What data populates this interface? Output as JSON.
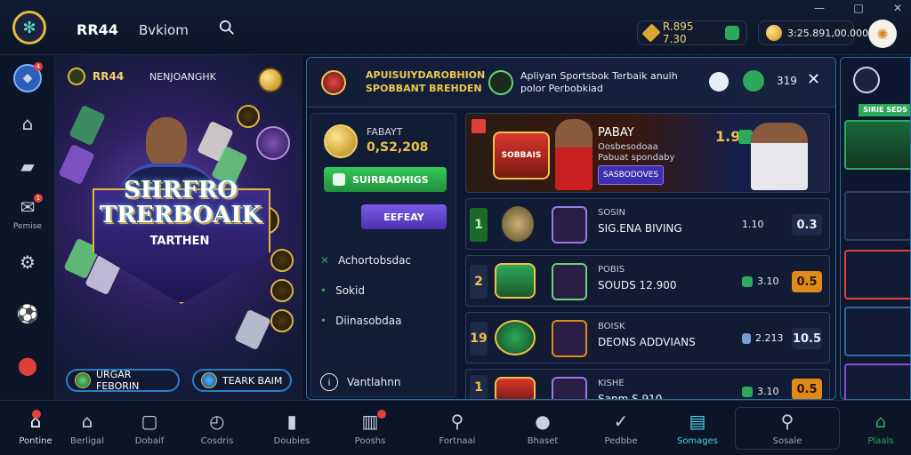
{
  "header": {
    "brand": "RR44",
    "subtitle": "Bvkiom",
    "balance1": "R.895 7.30",
    "balance2": "3:25.891,00.000",
    "window_controls": [
      "—",
      "□",
      "✕"
    ]
  },
  "leftnav": {
    "items": [
      {
        "name": "shield",
        "label": ""
      },
      {
        "name": "home",
        "label": ""
      },
      {
        "name": "tickets",
        "label": ""
      },
      {
        "name": "inbox",
        "label": "Pemise"
      },
      {
        "name": "settings",
        "label": ""
      },
      {
        "name": "ball",
        "label": ""
      },
      {
        "name": "location",
        "label": ""
      }
    ]
  },
  "hero": {
    "top_label": "RR44",
    "top_sub": "NENJOANGHK",
    "title_line1": "SHRFRO",
    "title_line2": "TRERBOAIK",
    "tag": "TARTHEN",
    "btn_left": "URGAR FEBORIN",
    "btn_right": "TEARK BAIM"
  },
  "banner": {
    "text1_line1": "APUISUIYDAROBHION",
    "text1_line2": "SPOBBANT BREHDEN",
    "text2_line1": "Apliyan Sportsbok Terbaik anuih",
    "text2_line2": "polor Perbobkiad",
    "count": "319"
  },
  "sidepane": {
    "label": "FABAYT",
    "value": "0,S2,208",
    "btn1": "SUIRBADHIGS",
    "btn2": "EEFEAY",
    "links": [
      "Achortobsdac",
      "Sokid",
      "Diinasobdaa",
      "Vantlahnn"
    ]
  },
  "feature": {
    "title": "PABAY",
    "sub1": "Oosbesodoaa",
    "sub2": "Pabuat spondaby",
    "badge": "SOBBAIS",
    "button": "SASBODOVES",
    "score": "1.9"
  },
  "matches": [
    {
      "num": "1",
      "t1": "SOSIN",
      "t2": "SIG.ENA BIVING",
      "score": "1.10",
      "odds": "0.3"
    },
    {
      "num": "2",
      "t1": "POBIS",
      "t2": "SOUDS 12.900",
      "score": "3.10",
      "odds": "0.5"
    },
    {
      "num": "19",
      "t1": "BOISK",
      "t2": "DEONS ADDVIANS",
      "score": "2.213",
      "odds": "10.5"
    },
    {
      "num": "1",
      "t1": "KISHE",
      "t2": "Sanm S.910",
      "score": "3.10",
      "odds": "0.5"
    }
  ],
  "rightpanel": {
    "header": "SIRIE SEDS"
  },
  "bottombar": {
    "items": [
      {
        "label": "Pontine",
        "icon": "home-icon"
      },
      {
        "label": "Berligal",
        "icon": "store-icon"
      },
      {
        "label": "Dobaif",
        "icon": "screen-icon"
      },
      {
        "label": "Cosdris",
        "icon": "clock-icon"
      },
      {
        "label": "Doubies",
        "icon": "card-icon"
      },
      {
        "label": "Pooshs",
        "icon": "bars-icon"
      },
      {
        "label": "Fortnaal",
        "icon": "search-icon"
      },
      {
        "label": "Bhaset",
        "icon": "user-icon"
      },
      {
        "label": "Pedbbe",
        "icon": "check-icon"
      },
      {
        "label": "Somages",
        "icon": "doc-icon"
      },
      {
        "label": "Sosale",
        "icon": "search-icon"
      },
      {
        "label": "Plaals",
        "icon": "lock-icon"
      }
    ]
  },
  "colors": {
    "accent_gold": "#f0c24a",
    "accent_green": "#2dbf4e",
    "accent_purple": "#6a4ad8",
    "border_blue": "#2c6e9a"
  }
}
